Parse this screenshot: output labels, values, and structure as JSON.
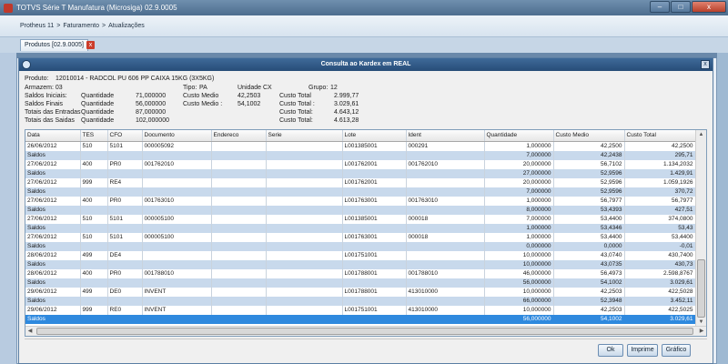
{
  "window": {
    "title": "TOTVS Série T Manufatura (Microsiga) 02.9.0005",
    "min": "–",
    "max": "□",
    "close": "x"
  },
  "breadcrumb": [
    "Protheus 11",
    "Faturamento",
    "Atualizações"
  ],
  "breadcrumb_sep": ">",
  "tab": {
    "label": "Produtos [02.9.0005]",
    "close": "x"
  },
  "dialog": {
    "title": "Consulta ao Kardex em REAL",
    "close": "x"
  },
  "info": {
    "produto_label": "Produto:",
    "produto_value": "12010014 - RADCOL PU 606 PP CAIXA 15KG (3X5KG)",
    "armazem": "Armazem: 03",
    "tipo_label": "Tipo:",
    "tipo_value": "PA",
    "unidade_label": "Unidade",
    "unidade_value": "CX",
    "grupo_label": "Grupo:",
    "grupo_value": "12",
    "saldos_iniciais": "Saldos Iniciais:",
    "saldos_finais": "Saldos Finais",
    "totais_entradas": "Totais das Entradas",
    "totais_saidas": "Totais das Saidas",
    "quantidade": "Quantidade",
    "qtd_iniciais": "71,000000",
    "qtd_finais": "56,000000",
    "qtd_entradas": "87,000000",
    "qtd_saidas": "102,000000",
    "custo_medio": "Custo Medio",
    "custo_medio2": "Custo Medio :",
    "cm_iniciais": "42,2503",
    "cm_finais": "54,1002",
    "custo_total": "Custo Total",
    "custo_total2": "Custo Total :",
    "custo_total3": "Custo Total:",
    "ct_iniciais": "2.999,77",
    "ct_finais": "3.029,61",
    "ct_entradas": "4.643,12",
    "ct_saidas": "4.613,28"
  },
  "grid": {
    "headers": [
      "Data",
      "TES",
      "CFO",
      "Documento",
      "Endereco",
      "Serie",
      "Lote",
      "Ident",
      "Quantidade",
      "Custo Medio",
      "Custo Total"
    ],
    "rows": [
      {
        "type": "data",
        "cells": [
          "26/06/2012",
          "510",
          "5101",
          "000005092",
          "",
          "",
          "L001385001",
          "000291",
          "1,000000",
          "42,2500",
          "42,2500"
        ]
      },
      {
        "type": "sub",
        "cells": [
          "Saldos",
          "",
          "",
          "",
          "",
          "",
          "",
          "",
          "7,000000",
          "42,2438",
          "295,71"
        ]
      },
      {
        "type": "data",
        "cells": [
          "27/06/2012",
          "400",
          "PR0",
          "001762010",
          "",
          "",
          "L001762001",
          "001762010",
          "20,000000",
          "56,7102",
          "1.134,2032"
        ]
      },
      {
        "type": "sub",
        "cells": [
          "Saldos",
          "",
          "",
          "",
          "",
          "",
          "",
          "",
          "27,000000",
          "52,9596",
          "1.429,91"
        ]
      },
      {
        "type": "data",
        "cells": [
          "27/06/2012",
          "999",
          "RE4",
          "",
          "",
          "",
          "L001762001",
          "",
          "20,000000",
          "52,9596",
          "1.059,1926"
        ]
      },
      {
        "type": "sub",
        "cells": [
          "Saldos",
          "",
          "",
          "",
          "",
          "",
          "",
          "",
          "7,000000",
          "52,9596",
          "370,72"
        ]
      },
      {
        "type": "data",
        "cells": [
          "27/06/2012",
          "400",
          "PR0",
          "001763010",
          "",
          "",
          "L001763001",
          "001763010",
          "1,000000",
          "56,7977",
          "56,7977"
        ]
      },
      {
        "type": "sub",
        "cells": [
          "Saldos",
          "",
          "",
          "",
          "",
          "",
          "",
          "",
          "8,000000",
          "53,4393",
          "427,51"
        ]
      },
      {
        "type": "data",
        "cells": [
          "27/06/2012",
          "510",
          "5101",
          "000005100",
          "",
          "",
          "L001385001",
          "000018",
          "7,000000",
          "53,4400",
          "374,0800"
        ]
      },
      {
        "type": "sub",
        "cells": [
          "Saldos",
          "",
          "",
          "",
          "",
          "",
          "",
          "",
          "1,000000",
          "53,4346",
          "53,43"
        ]
      },
      {
        "type": "data",
        "cells": [
          "27/06/2012",
          "510",
          "5101",
          "000005100",
          "",
          "",
          "L001763001",
          "000018",
          "1,000000",
          "53,4400",
          "53,4400"
        ]
      },
      {
        "type": "sub",
        "cells": [
          "Saldos",
          "",
          "",
          "",
          "",
          "",
          "",
          "",
          "0,000000",
          "0,0000",
          "-0,01"
        ]
      },
      {
        "type": "data",
        "cells": [
          "28/06/2012",
          "499",
          "DE4",
          "",
          "",
          "",
          "L001751001",
          "",
          "10,000000",
          "43,0740",
          "430,7400"
        ]
      },
      {
        "type": "sub",
        "cells": [
          "Saldos",
          "",
          "",
          "",
          "",
          "",
          "",
          "",
          "10,000000",
          "43,0735",
          "430,73"
        ]
      },
      {
        "type": "data",
        "cells": [
          "28/06/2012",
          "400",
          "PR0",
          "001788010",
          "",
          "",
          "L001788001",
          "001788010",
          "46,000000",
          "56,4973",
          "2.598,8767"
        ]
      },
      {
        "type": "sub",
        "cells": [
          "Saldos",
          "",
          "",
          "",
          "",
          "",
          "",
          "",
          "56,000000",
          "54,1002",
          "3.029,61"
        ]
      },
      {
        "type": "data",
        "cells": [
          "29/06/2012",
          "499",
          "DE0",
          "INVENT",
          "",
          "",
          "L001788001",
          "413010000",
          "10,000000",
          "42,2503",
          "422,5028"
        ]
      },
      {
        "type": "sub",
        "cells": [
          "Saldos",
          "",
          "",
          "",
          "",
          "",
          "",
          "",
          "66,000000",
          "52,3948",
          "3.452,11"
        ]
      },
      {
        "type": "data",
        "cells": [
          "29/06/2012",
          "999",
          "RE0",
          "INVENT",
          "",
          "",
          "L001751001",
          "413010000",
          "10,000000",
          "42,2503",
          "422,5025"
        ]
      },
      {
        "type": "sel",
        "cells": [
          "Saldos",
          "",
          "",
          "",
          "",
          "",
          "",
          "",
          "56,000000",
          "54,1002",
          "3.029,61"
        ]
      }
    ]
  },
  "buttons": {
    "ok": "Ok",
    "imprime": "Imprime",
    "grafico": "Gráfico"
  },
  "colors": {
    "selected_row": "#2f89de",
    "subtotal_row": "#c8d9ec",
    "title_bar": "#274d78"
  }
}
